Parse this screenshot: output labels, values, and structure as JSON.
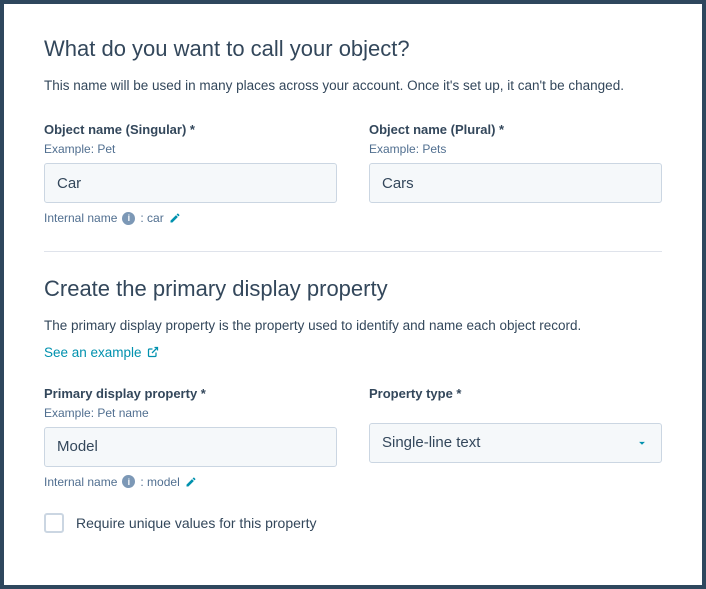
{
  "section1": {
    "heading": "What do you want to call your object?",
    "description": "This name will be used in many places across your account. Once it's set up, it can't be changed.",
    "singular": {
      "label": "Object name (Singular) *",
      "example": "Example: Pet",
      "value": "Car"
    },
    "plural": {
      "label": "Object name (Plural) *",
      "example": "Example: Pets",
      "value": "Cars"
    },
    "internal_name_label": "Internal name",
    "internal_name_value": ": car"
  },
  "section2": {
    "heading": "Create the primary display property",
    "description": "The primary display property is the property used to identify and name each object record.",
    "see_example": "See an example",
    "primary_property": {
      "label": "Primary display property *",
      "example": "Example: Pet name",
      "value": "Model"
    },
    "property_type": {
      "label": "Property type *",
      "value": "Single-line text"
    },
    "internal_name_label": "Internal name",
    "internal_name_value": ": model",
    "require_unique": "Require unique values for this property"
  }
}
